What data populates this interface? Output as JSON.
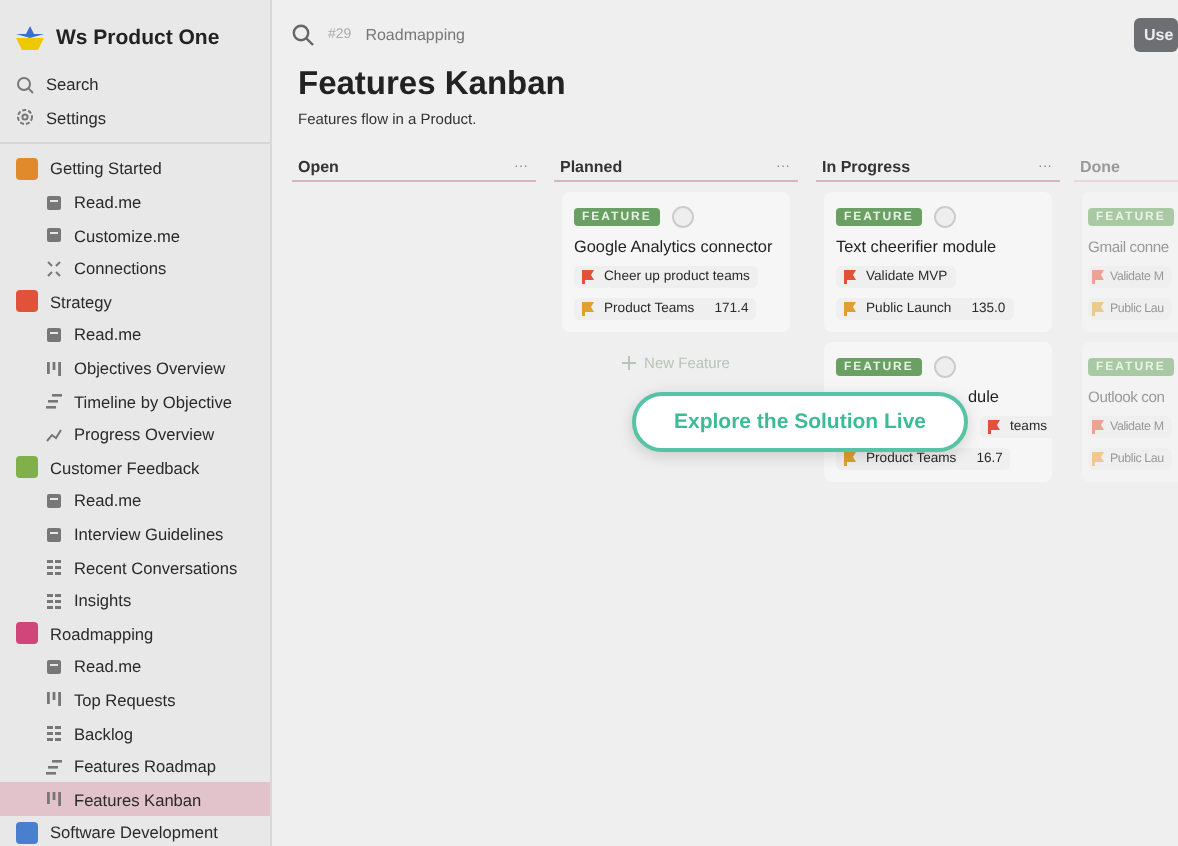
{
  "workspace": {
    "name": "Ws Product One"
  },
  "nav": [
    {
      "label": "Search",
      "kind": "search"
    },
    {
      "label": "Settings",
      "kind": "settings"
    }
  ],
  "sidebar": {
    "sections": [
      {
        "label": "Getting Started",
        "color": "#e08a2c",
        "children": [
          {
            "label": "Read.me",
            "kind": "doc",
            "selected": false
          },
          {
            "label": "Customize.me",
            "kind": "doc",
            "selected": false
          },
          {
            "label": "Connections",
            "kind": "links",
            "selected": false
          }
        ]
      },
      {
        "label": "Strategy",
        "color": "#e0523a",
        "children": [
          {
            "label": "Read.me",
            "kind": "doc",
            "selected": false
          },
          {
            "label": "Objectives Overview",
            "kind": "board",
            "selected": false
          },
          {
            "label": "Timeline by Objective",
            "kind": "timeline",
            "selected": false
          },
          {
            "label": "Progress Overview",
            "kind": "chart",
            "selected": false
          }
        ]
      },
      {
        "label": "Customer Feedback",
        "color": "#7fb04a",
        "children": [
          {
            "label": "Read.me",
            "kind": "doc",
            "selected": false
          },
          {
            "label": "Interview Guidelines",
            "kind": "doc",
            "selected": false
          },
          {
            "label": "Recent Conversations",
            "kind": "table",
            "selected": false
          },
          {
            "label": "Insights",
            "kind": "table",
            "selected": false
          }
        ]
      },
      {
        "label": "Roadmapping",
        "color": "#d0457a",
        "children": [
          {
            "label": "Read.me",
            "kind": "doc",
            "selected": false
          },
          {
            "label": "Top Requests",
            "kind": "board",
            "selected": false
          },
          {
            "label": "Backlog",
            "kind": "table",
            "selected": false
          },
          {
            "label": "Features Roadmap",
            "kind": "timeline",
            "selected": false
          },
          {
            "label": "Features Kanban",
            "kind": "board",
            "selected": true
          }
        ]
      },
      {
        "label": "Software Development",
        "color": "#4a7fd0"
      }
    ]
  },
  "topbar": {
    "count": "#29",
    "breadcrumb": "Roadmapping",
    "button": "Use"
  },
  "page": {
    "title": "Features Kanban",
    "subtitle": "Features flow in a Product."
  },
  "columns": [
    {
      "title": "Open",
      "more": "···"
    },
    {
      "title": "Planned",
      "more": "···",
      "new_item": "New Feature",
      "cards": [
        {
          "badge": "FEATURE",
          "title": "Google Analytics connector",
          "covered": false,
          "tags": [
            {
              "label": "Cheer up product teams",
              "color": "#e0523a"
            },
            {
              "label": "Product Teams",
              "color": "#e0a030",
              "value": "171.4"
            }
          ]
        }
      ]
    },
    {
      "title": "In Progress",
      "more": "···",
      "cards": [
        {
          "badge": "FEATURE",
          "title": "Text cheerifier module",
          "covered": false,
          "tags": [
            {
              "label": "Validate MVP",
              "color": "#e0523a"
            },
            {
              "label": "Public Launch",
              "color": "#e0a030",
              "value": "135.0"
            }
          ]
        },
        {
          "badge": "FEATURE",
          "title": "dule",
          "covered": true,
          "tags": [
            {
              "label": "teams",
              "color": "#e0523a"
            },
            {
              "label": "Product Teams",
              "color": "#e0a030",
              "value": "16.7"
            }
          ]
        }
      ]
    },
    {
      "title": "Done",
      "cards": [
        {
          "badge": "FEATURE",
          "title": "Gmail conne",
          "covered": false,
          "tags": [
            {
              "label": "Validate M",
              "color": "#eda392"
            },
            {
              "label": "Public Lau",
              "color": "#eec98f"
            }
          ]
        },
        {
          "badge": "FEATURE",
          "title": "Outlook con",
          "covered": false,
          "tags": [
            {
              "label": "Validate M",
              "color": "#eda392"
            },
            {
              "label": "Public Lau",
              "color": "#eec98f"
            }
          ]
        }
      ]
    }
  ],
  "cta": {
    "label": "Explore the Solution Live"
  }
}
